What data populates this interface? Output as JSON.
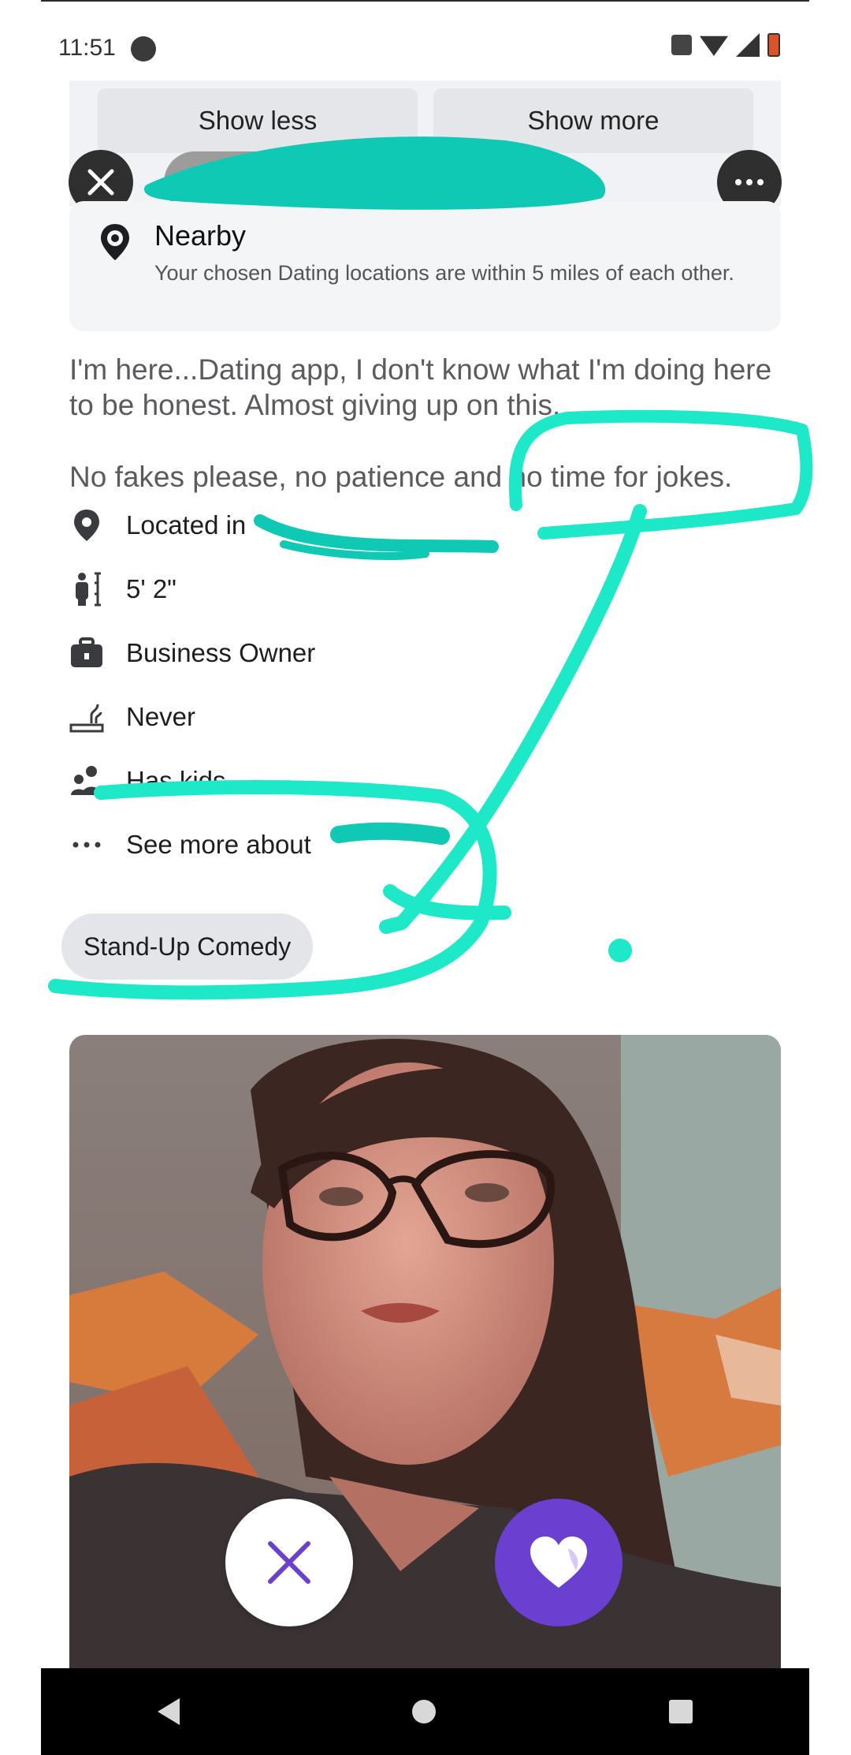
{
  "status_bar": {
    "time": "11:51"
  },
  "top_buttons": {
    "show_less": "Show less",
    "show_more": "Show more"
  },
  "nearby": {
    "title": "Nearby",
    "description": "Your chosen Dating locations are within 5 miles of each other."
  },
  "bio": {
    "paragraph1": "I'm here...Dating app, I don't know what I'm doing here to be honest. Almost giving up on this.",
    "paragraph2": "No fakes please, no patience and no time for jokes."
  },
  "details": {
    "location": "Located in",
    "height": "5' 2\"",
    "job": "Business Owner",
    "smoking": "Never",
    "kids": "Has kids",
    "see_more": "See more about"
  },
  "interests": [
    "Stand-Up Comedy"
  ],
  "colors": {
    "accent": "#6b3fd0",
    "annotation": "#1de9c8"
  },
  "icons": [
    "close-icon",
    "more-icon",
    "nearby-icon",
    "location-pin-icon",
    "height-icon",
    "briefcase-icon",
    "smoking-icon",
    "kids-icon",
    "dots-icon",
    "heart-icon",
    "nav-back-icon",
    "nav-home-icon",
    "nav-recent-icon"
  ]
}
